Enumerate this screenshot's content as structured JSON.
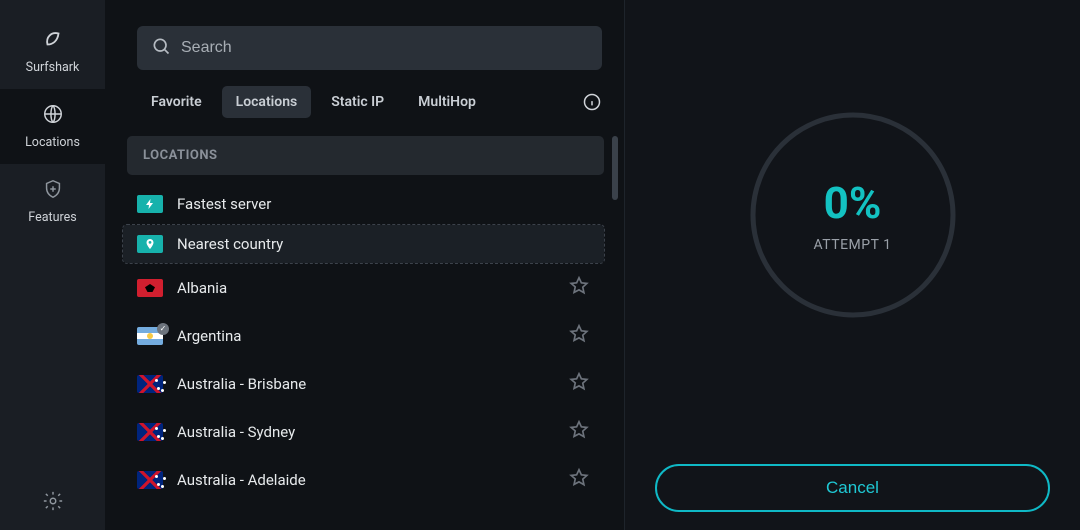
{
  "sidebar": {
    "brand": "Surfshark",
    "items": [
      {
        "label": "Locations",
        "active": true
      },
      {
        "label": "Features",
        "active": false
      }
    ],
    "settings_label": "Settings"
  },
  "search": {
    "placeholder": "Search"
  },
  "tabs": {
    "items": [
      {
        "label": "Favorite",
        "active": false
      },
      {
        "label": "Locations",
        "active": true
      },
      {
        "label": "Static IP",
        "active": false
      },
      {
        "label": "MultiHop",
        "active": false
      }
    ]
  },
  "list": {
    "section_header": "LOCATIONS",
    "fastest_label": "Fastest server",
    "nearest_label": "Nearest country",
    "countries": [
      {
        "name": "Albania",
        "flag": "al",
        "verified": false
      },
      {
        "name": "Argentina",
        "flag": "ar",
        "verified": true
      },
      {
        "name": "Australia - Brisbane",
        "flag": "au",
        "verified": false
      },
      {
        "name": "Australia - Sydney",
        "flag": "au",
        "verified": false
      },
      {
        "name": "Australia - Adelaide",
        "flag": "au",
        "verified": false
      }
    ]
  },
  "status": {
    "percent_text": "0%",
    "attempt_text": "ATTEMPT 1",
    "cancel_label": "Cancel"
  },
  "colors": {
    "accent": "#13c2c2"
  }
}
